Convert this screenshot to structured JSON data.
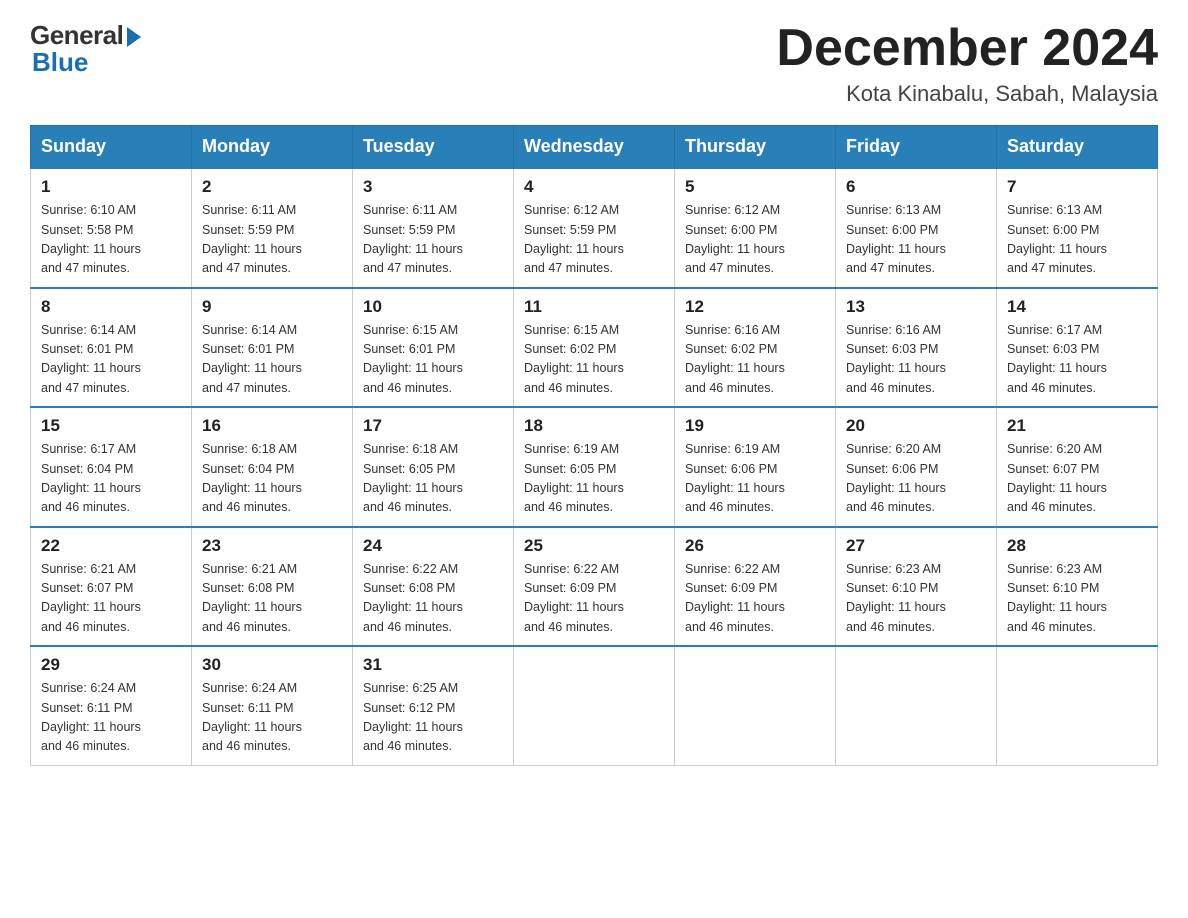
{
  "header": {
    "logo_general": "General",
    "logo_blue": "Blue",
    "month_title": "December 2024",
    "subtitle": "Kota Kinabalu, Sabah, Malaysia"
  },
  "days_of_week": [
    "Sunday",
    "Monday",
    "Tuesday",
    "Wednesday",
    "Thursday",
    "Friday",
    "Saturday"
  ],
  "weeks": [
    [
      {
        "day": "1",
        "sunrise": "6:10 AM",
        "sunset": "5:58 PM",
        "daylight": "11 hours and 47 minutes."
      },
      {
        "day": "2",
        "sunrise": "6:11 AM",
        "sunset": "5:59 PM",
        "daylight": "11 hours and 47 minutes."
      },
      {
        "day": "3",
        "sunrise": "6:11 AM",
        "sunset": "5:59 PM",
        "daylight": "11 hours and 47 minutes."
      },
      {
        "day": "4",
        "sunrise": "6:12 AM",
        "sunset": "5:59 PM",
        "daylight": "11 hours and 47 minutes."
      },
      {
        "day": "5",
        "sunrise": "6:12 AM",
        "sunset": "6:00 PM",
        "daylight": "11 hours and 47 minutes."
      },
      {
        "day": "6",
        "sunrise": "6:13 AM",
        "sunset": "6:00 PM",
        "daylight": "11 hours and 47 minutes."
      },
      {
        "day": "7",
        "sunrise": "6:13 AM",
        "sunset": "6:00 PM",
        "daylight": "11 hours and 47 minutes."
      }
    ],
    [
      {
        "day": "8",
        "sunrise": "6:14 AM",
        "sunset": "6:01 PM",
        "daylight": "11 hours and 47 minutes."
      },
      {
        "day": "9",
        "sunrise": "6:14 AM",
        "sunset": "6:01 PM",
        "daylight": "11 hours and 47 minutes."
      },
      {
        "day": "10",
        "sunrise": "6:15 AM",
        "sunset": "6:01 PM",
        "daylight": "11 hours and 46 minutes."
      },
      {
        "day": "11",
        "sunrise": "6:15 AM",
        "sunset": "6:02 PM",
        "daylight": "11 hours and 46 minutes."
      },
      {
        "day": "12",
        "sunrise": "6:16 AM",
        "sunset": "6:02 PM",
        "daylight": "11 hours and 46 minutes."
      },
      {
        "day": "13",
        "sunrise": "6:16 AM",
        "sunset": "6:03 PM",
        "daylight": "11 hours and 46 minutes."
      },
      {
        "day": "14",
        "sunrise": "6:17 AM",
        "sunset": "6:03 PM",
        "daylight": "11 hours and 46 minutes."
      }
    ],
    [
      {
        "day": "15",
        "sunrise": "6:17 AM",
        "sunset": "6:04 PM",
        "daylight": "11 hours and 46 minutes."
      },
      {
        "day": "16",
        "sunrise": "6:18 AM",
        "sunset": "6:04 PM",
        "daylight": "11 hours and 46 minutes."
      },
      {
        "day": "17",
        "sunrise": "6:18 AM",
        "sunset": "6:05 PM",
        "daylight": "11 hours and 46 minutes."
      },
      {
        "day": "18",
        "sunrise": "6:19 AM",
        "sunset": "6:05 PM",
        "daylight": "11 hours and 46 minutes."
      },
      {
        "day": "19",
        "sunrise": "6:19 AM",
        "sunset": "6:06 PM",
        "daylight": "11 hours and 46 minutes."
      },
      {
        "day": "20",
        "sunrise": "6:20 AM",
        "sunset": "6:06 PM",
        "daylight": "11 hours and 46 minutes."
      },
      {
        "day": "21",
        "sunrise": "6:20 AM",
        "sunset": "6:07 PM",
        "daylight": "11 hours and 46 minutes."
      }
    ],
    [
      {
        "day": "22",
        "sunrise": "6:21 AM",
        "sunset": "6:07 PM",
        "daylight": "11 hours and 46 minutes."
      },
      {
        "day": "23",
        "sunrise": "6:21 AM",
        "sunset": "6:08 PM",
        "daylight": "11 hours and 46 minutes."
      },
      {
        "day": "24",
        "sunrise": "6:22 AM",
        "sunset": "6:08 PM",
        "daylight": "11 hours and 46 minutes."
      },
      {
        "day": "25",
        "sunrise": "6:22 AM",
        "sunset": "6:09 PM",
        "daylight": "11 hours and 46 minutes."
      },
      {
        "day": "26",
        "sunrise": "6:22 AM",
        "sunset": "6:09 PM",
        "daylight": "11 hours and 46 minutes."
      },
      {
        "day": "27",
        "sunrise": "6:23 AM",
        "sunset": "6:10 PM",
        "daylight": "11 hours and 46 minutes."
      },
      {
        "day": "28",
        "sunrise": "6:23 AM",
        "sunset": "6:10 PM",
        "daylight": "11 hours and 46 minutes."
      }
    ],
    [
      {
        "day": "29",
        "sunrise": "6:24 AM",
        "sunset": "6:11 PM",
        "daylight": "11 hours and 46 minutes."
      },
      {
        "day": "30",
        "sunrise": "6:24 AM",
        "sunset": "6:11 PM",
        "daylight": "11 hours and 46 minutes."
      },
      {
        "day": "31",
        "sunrise": "6:25 AM",
        "sunset": "6:12 PM",
        "daylight": "11 hours and 46 minutes."
      },
      null,
      null,
      null,
      null
    ]
  ],
  "labels": {
    "sunrise": "Sunrise:",
    "sunset": "Sunset:",
    "daylight": "Daylight:"
  }
}
